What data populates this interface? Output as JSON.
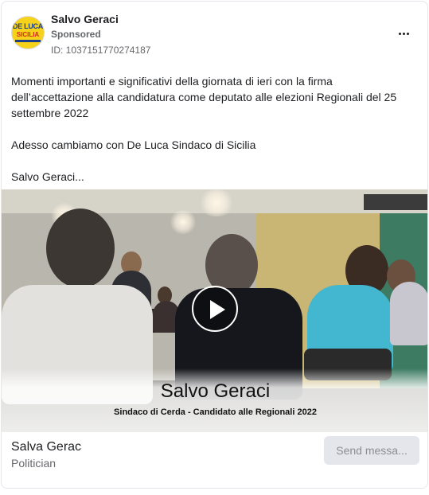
{
  "post": {
    "page_name": "Salvo Geraci",
    "sponsored_label": "Sponsored",
    "ad_id": "ID: 1037151770274187",
    "more_icon": "more-horizontal-icon",
    "avatar_logo": {
      "line1": "DE LUCA",
      "line2": "SICILIA",
      "colors": {
        "bg": "#f7d21a",
        "blue": "#1d3e8a",
        "red": "#d7261e"
      }
    },
    "body_paragraphs": [
      "Momenti importanti e significativi della giornata di ieri con la firma dell’accettazione alla candidatura come deputato alle elezioni Regionali del 25 settembre 2022",
      "Adesso cambiamo con De Luca Sindaco di Sicilia",
      "Salvo Geraci..."
    ]
  },
  "video": {
    "play_icon": "play-icon",
    "title": "Salvo Geraci",
    "subtitle": "Sindaco di Cerda - Candidato alle Regionali 2022"
  },
  "footer": {
    "name": "Salva Gerac",
    "category": "Politician",
    "cta_label": "Send messa..."
  },
  "colors": {
    "text_primary": "#1c1e21",
    "text_secondary": "#65676b",
    "button_bg": "#e4e6eb",
    "button_text": "#8a8d91"
  }
}
